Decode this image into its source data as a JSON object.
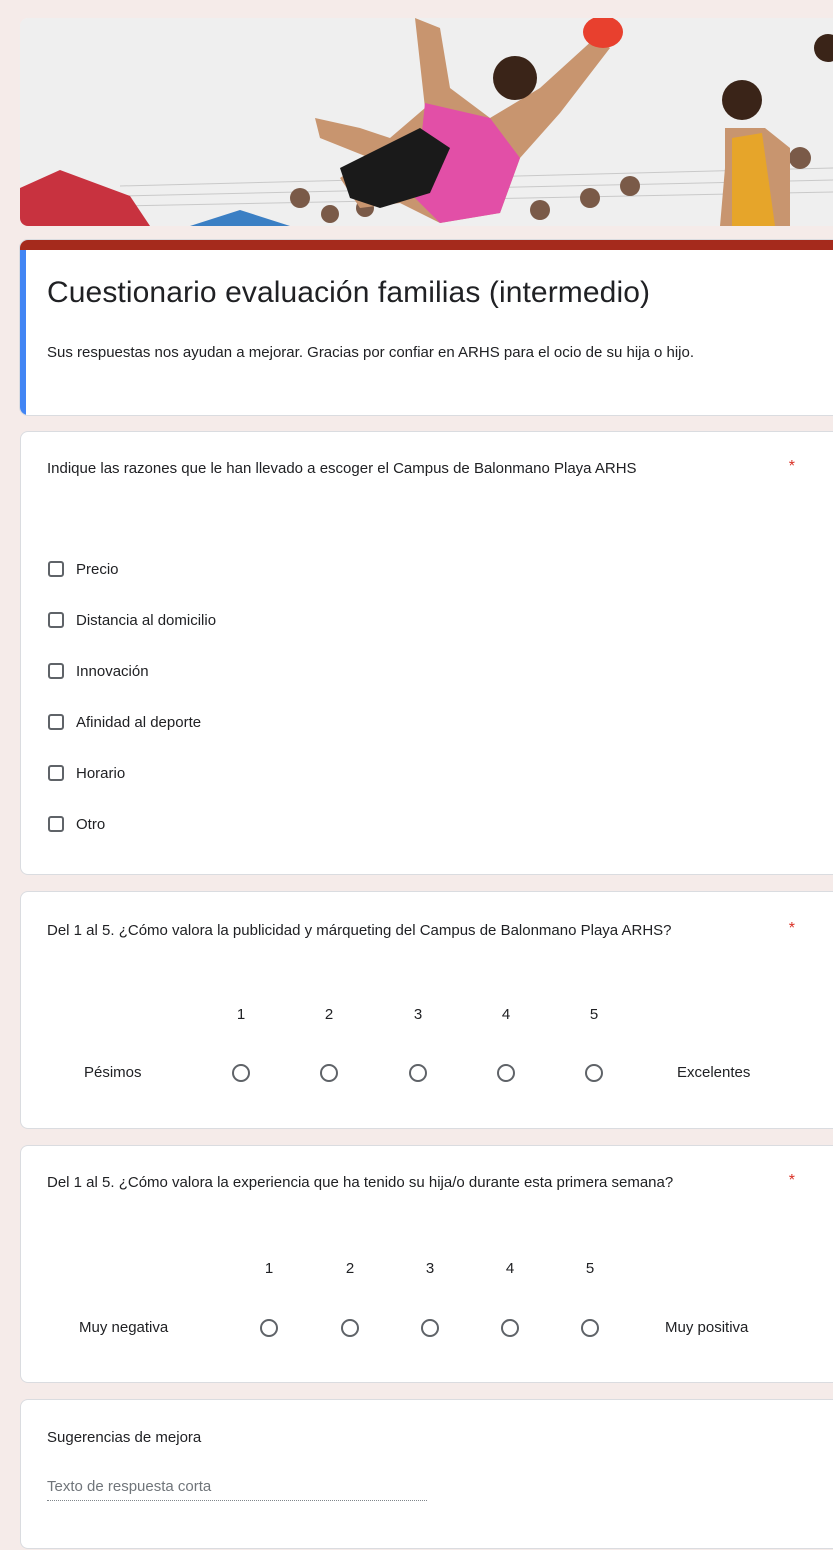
{
  "form": {
    "title": "Cuestionario evaluación familias (intermedio)",
    "description": "Sus respuestas nos ayudan a mejorar. Gracias por confiar en ARHS para el ocio de su hija o hijo.",
    "required_mark": "*"
  },
  "questions": {
    "q1": {
      "title": "Indique las razones que le han llevado a escoger el Campus de Balonmano Playa ARHS",
      "options": [
        "Precio",
        "Distancia al domicilio",
        "Innovación",
        "Afinidad al deporte",
        "Horario",
        "Otro"
      ]
    },
    "q2": {
      "title": "Del 1 al 5. ¿Cómo valora la publicidad y márqueting del Campus de Balonmano Playa ARHS?",
      "scale": [
        "1",
        "2",
        "3",
        "4",
        "5"
      ],
      "low_label": "Pésimos",
      "high_label": "Excelentes"
    },
    "q3": {
      "title": "Del 1 al 5. ¿Cómo valora la experiencia que ha tenido su hija/o durante esta primera semana?",
      "scale": [
        "1",
        "2",
        "3",
        "4",
        "5"
      ],
      "low_label": "Muy negativa",
      "high_label": "Muy positiva"
    },
    "q4": {
      "title": "Sugerencias de mejora",
      "placeholder": "Texto de respuesta corta"
    }
  },
  "colors": {
    "page_background": "#f5ebe9",
    "theme_bar": "#a52a1c",
    "focus_bar": "#4285f4",
    "required": "#d93025"
  }
}
